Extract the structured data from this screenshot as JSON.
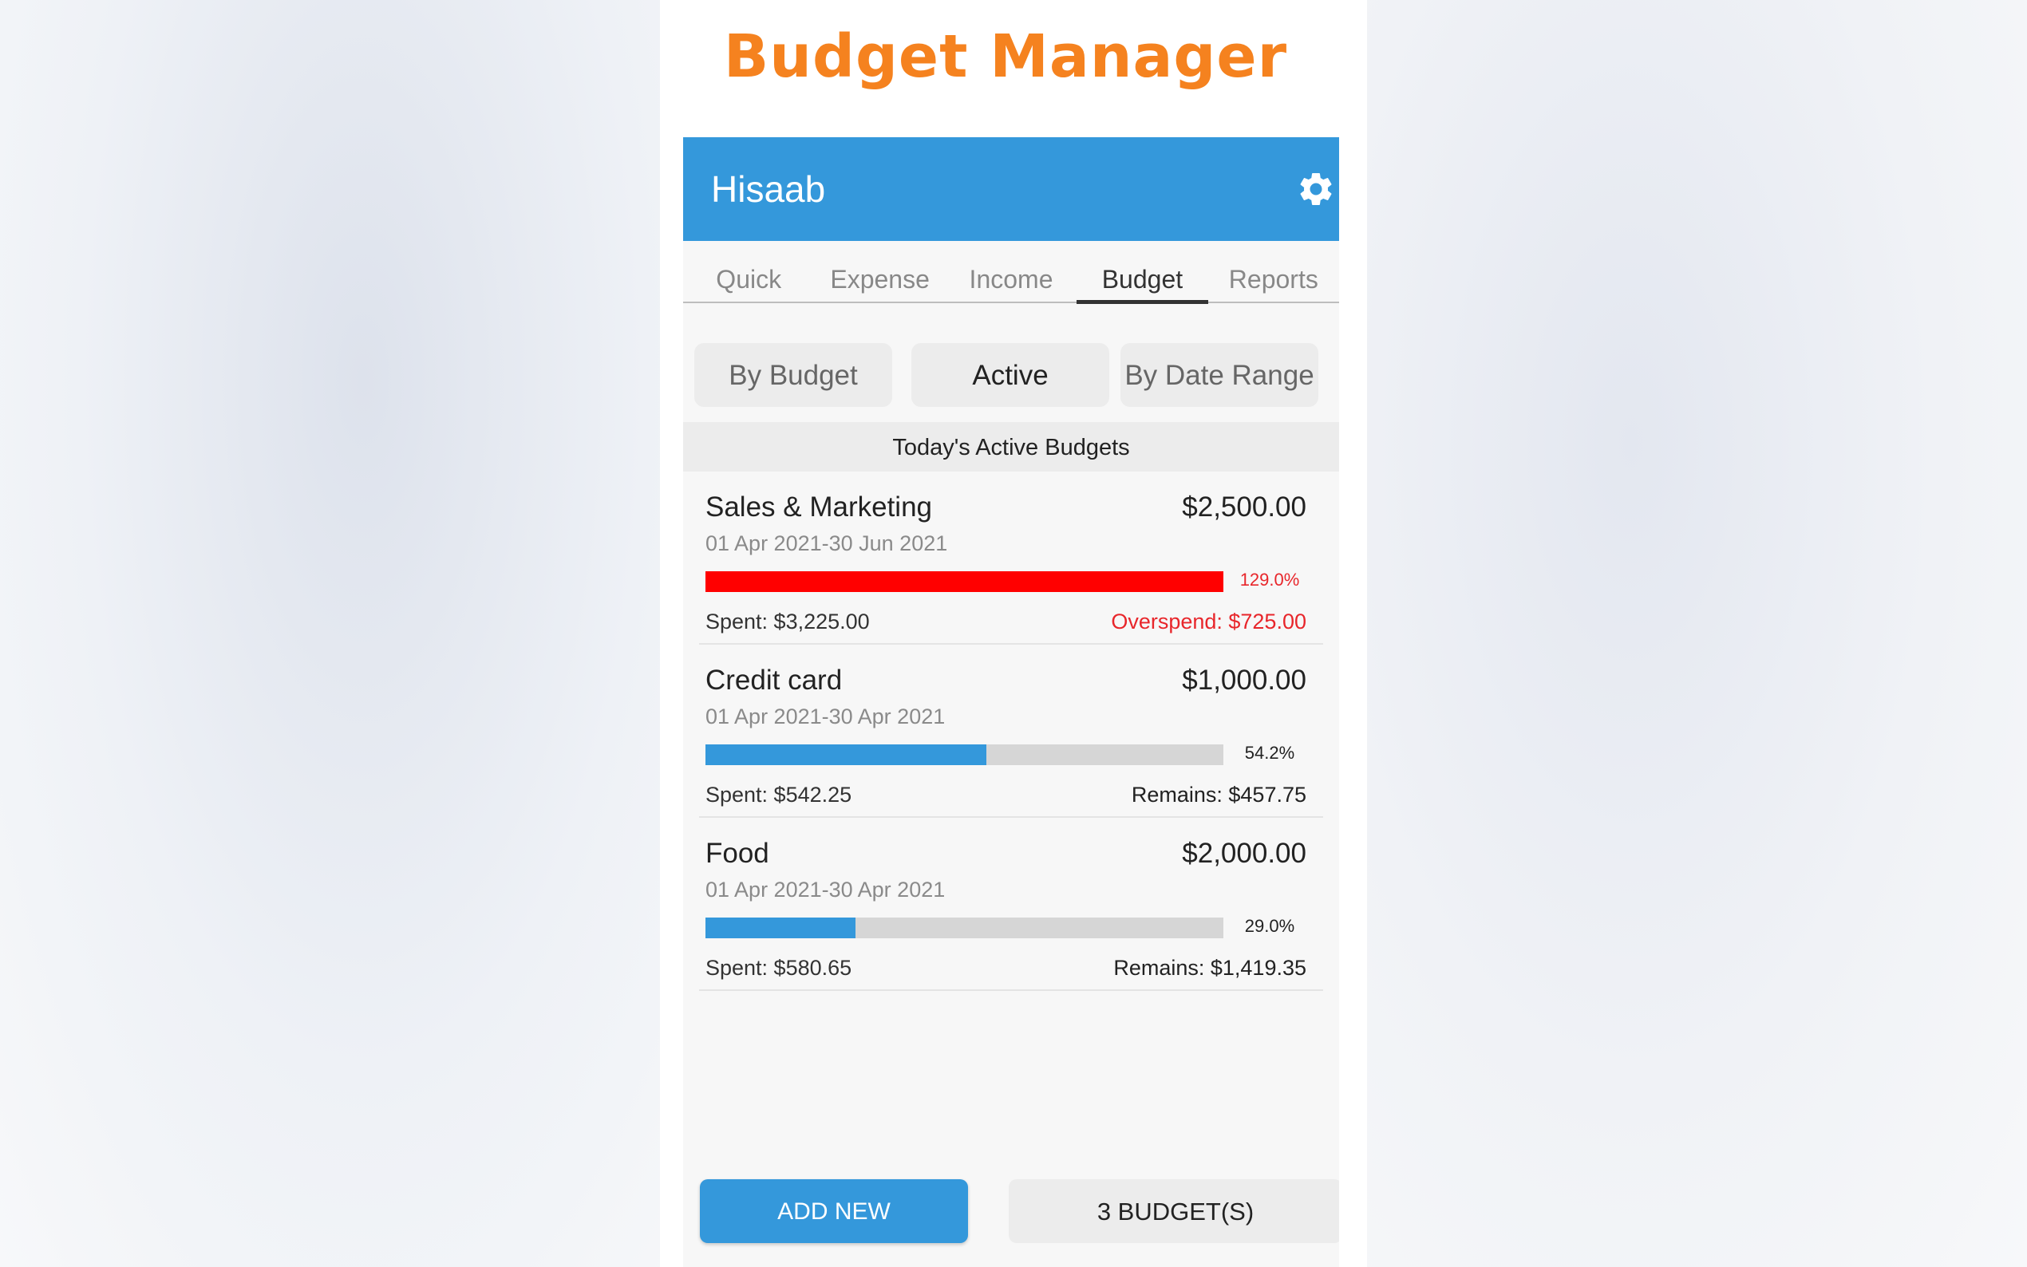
{
  "banner": {
    "title": "Budget Manager"
  },
  "toolbar": {
    "title": "Hisaab",
    "settings_icon": "gear-icon"
  },
  "tabs": [
    {
      "label": "Quick"
    },
    {
      "label": "Expense"
    },
    {
      "label": "Income"
    },
    {
      "label": "Budget"
    },
    {
      "label": "Reports"
    }
  ],
  "active_tab": "Budget",
  "segments": [
    {
      "label": "By Budget"
    },
    {
      "label": "Active"
    },
    {
      "label": "By Date Range"
    }
  ],
  "active_segment": "Active",
  "section_header": "Today's Active Budgets",
  "budgets": [
    {
      "name": "Sales & Marketing",
      "amount": "$2,500.00",
      "dates": "01 Apr 2021-30 Jun 2021",
      "percent_label": "129.0%",
      "progress": 1.0,
      "spent": "Spent: $3,225.00",
      "remaining": "Overspend: $725.00",
      "status": "over"
    },
    {
      "name": "Credit card",
      "amount": "$1,000.00",
      "dates": "01 Apr 2021-30 Apr 2021",
      "percent_label": "54.2%",
      "progress": 0.542,
      "spent": "Spent: $542.25",
      "remaining": "Remains: $457.75",
      "status": "ok"
    },
    {
      "name": "Food",
      "amount": "$2,000.00",
      "dates": "01 Apr 2021-30 Apr 2021",
      "percent_label": "29.0%",
      "progress": 0.29,
      "spent": "Spent: $580.65",
      "remaining": "Remains: $1,419.35",
      "status": "ok"
    }
  ],
  "footer": {
    "add_label": "ADD NEW",
    "count_label": "3 BUDGET(S)"
  },
  "colors": {
    "accent": "#3498db",
    "banner_title": "#f5821f",
    "over": "#ff0000",
    "over_text": "#e8262b",
    "ok": "#3498db"
  }
}
